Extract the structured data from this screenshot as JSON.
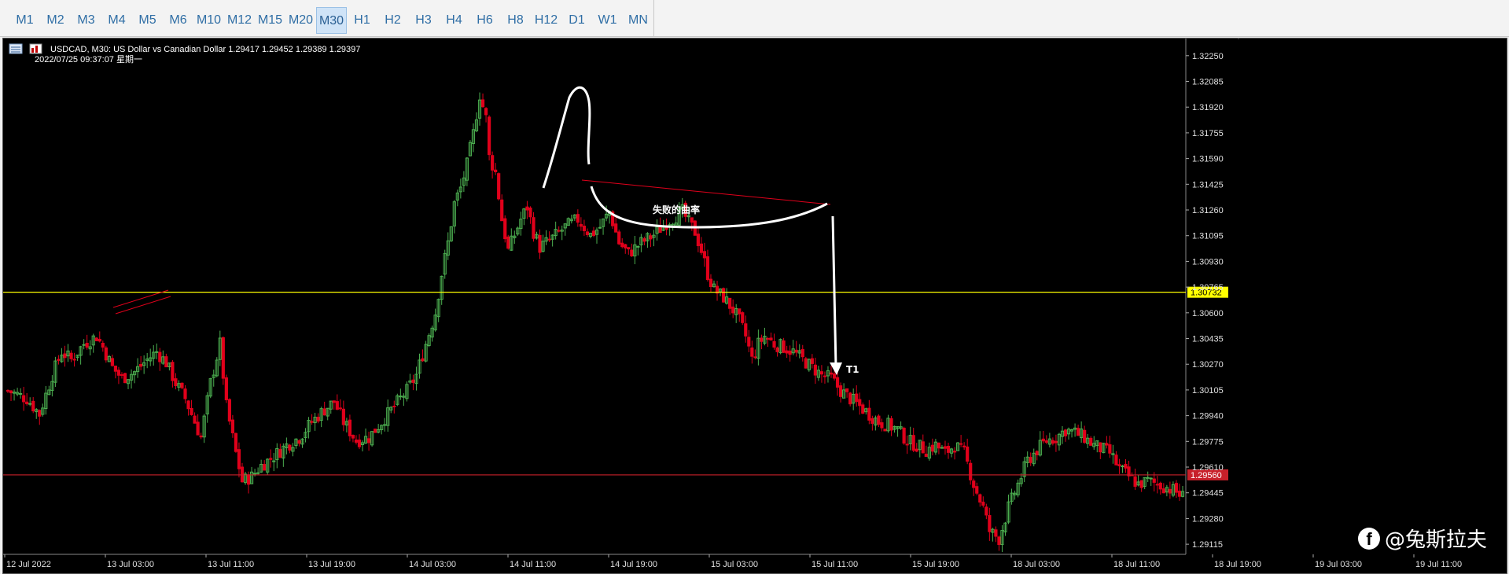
{
  "timeframes": [
    {
      "label": "M1"
    },
    {
      "label": "M2"
    },
    {
      "label": "M3"
    },
    {
      "label": "M4"
    },
    {
      "label": "M5"
    },
    {
      "label": "M6"
    },
    {
      "label": "M10"
    },
    {
      "label": "M12"
    },
    {
      "label": "M15"
    },
    {
      "label": "M20"
    },
    {
      "label": "M30",
      "active": true
    },
    {
      "label": "H1"
    },
    {
      "label": "H2"
    },
    {
      "label": "H3"
    },
    {
      "label": "H4"
    },
    {
      "label": "H6"
    },
    {
      "label": "H8"
    },
    {
      "label": "H12"
    },
    {
      "label": "D1"
    },
    {
      "label": "W1"
    },
    {
      "label": "MN"
    }
  ],
  "chart": {
    "header": "USDCAD, M30:  US Dollar vs Canadian Dollar  1.29417 1.29452 1.29389 1.29397",
    "datetime": "2022/07/25  09:37:07  星期一",
    "colors": {
      "background": "#000000",
      "bull": "#4caf50",
      "bear": "#e0001b",
      "yellow": "#ffff00",
      "red_line": "#c8202a",
      "text": "#ffffff",
      "axis_text": "#e0e0e0"
    }
  },
  "chart_data": {
    "type": "candlestick",
    "symbol": "USDCAD",
    "timeframe": "M30",
    "ylim": [
      1.2905,
      1.3235
    ],
    "price_ticks": [
      "1.32250",
      "1.32085",
      "1.31920",
      "1.31755",
      "1.31590",
      "1.31425",
      "1.31260",
      "1.31095",
      "1.30930",
      "1.30765",
      "1.30600",
      "1.30435",
      "1.30270",
      "1.30105",
      "1.29940",
      "1.29775",
      "1.29610",
      "1.29445",
      "1.29280",
      "1.29115"
    ],
    "time_labels": [
      "12 Jul 2022",
      "13 Jul 03:00",
      "13 Jul 11:00",
      "13 Jul 19:00",
      "14 Jul 03:00",
      "14 Jul 11:00",
      "14 Jul 19:00",
      "15 Jul 03:00",
      "15 Jul 11:00",
      "15 Jul 19:00",
      "18 Jul 03:00",
      "18 Jul 11:00",
      "18 Jul 19:00",
      "19 Jul 03:00",
      "19 Jul 11:00"
    ],
    "horizontal_lines": [
      {
        "price": 1.30732,
        "label": "1.30732",
        "color": "#ffff00"
      },
      {
        "price": 1.2956,
        "label": "1.29560",
        "color": "#c8202a"
      }
    ],
    "annotations": [
      {
        "text": "失败的曲率"
      },
      {
        "text": "T1"
      }
    ],
    "close_path": [
      [
        0,
        1.301
      ],
      [
        6,
        1.3005
      ],
      [
        10,
        1.2995
      ],
      [
        14,
        1.302
      ],
      [
        17,
        1.3035
      ],
      [
        20,
        1.303
      ],
      [
        24,
        1.304
      ],
      [
        28,
        1.3045
      ],
      [
        30,
        1.3038
      ],
      [
        33,
        1.3025
      ],
      [
        36,
        1.3018
      ],
      [
        40,
        1.3022
      ],
      [
        44,
        1.303
      ],
      [
        47,
        1.3035
      ],
      [
        50,
        1.3028
      ],
      [
        53,
        1.3015
      ],
      [
        56,
        1.3005
      ],
      [
        58,
        1.2995
      ],
      [
        61,
        1.298
      ],
      [
        64,
        1.3015
      ],
      [
        67,
        1.304
      ],
      [
        69,
        1.3
      ],
      [
        72,
        1.297
      ],
      [
        74,
        1.2952
      ],
      [
        77,
        1.2955
      ],
      [
        80,
        1.2962
      ],
      [
        84,
        1.2968
      ],
      [
        88,
        1.2975
      ],
      [
        92,
        1.298
      ],
      [
        96,
        1.299
      ],
      [
        100,
        1.2998
      ],
      [
        103,
        1.3003
      ],
      [
        106,
        1.299
      ],
      [
        110,
        1.2978
      ],
      [
        114,
        1.298
      ],
      [
        118,
        1.299
      ],
      [
        122,
        1.3
      ],
      [
        126,
        1.301
      ],
      [
        129,
        1.302
      ],
      [
        132,
        1.304
      ],
      [
        135,
        1.306
      ],
      [
        137,
        1.3085
      ],
      [
        139,
        1.3105
      ],
      [
        141,
        1.313
      ],
      [
        143,
        1.314
      ],
      [
        145,
        1.3155
      ],
      [
        147,
        1.3175
      ],
      [
        149,
        1.32
      ],
      [
        151,
        1.3185
      ],
      [
        152,
        1.316
      ],
      [
        154,
        1.315
      ],
      [
        156,
        1.312
      ],
      [
        158,
        1.31
      ],
      [
        160,
        1.311
      ],
      [
        162,
        1.312
      ],
      [
        164,
        1.3128
      ],
      [
        166,
        1.3112
      ],
      [
        168,
        1.3102
      ],
      [
        172,
        1.3108
      ],
      [
        176,
        1.3115
      ],
      [
        180,
        1.312
      ],
      [
        184,
        1.311
      ],
      [
        187,
        1.3115
      ],
      [
        190,
        1.3125
      ],
      [
        193,
        1.3105
      ],
      [
        196,
        1.3098
      ],
      [
        200,
        1.3105
      ],
      [
        204,
        1.311
      ],
      [
        208,
        1.3118
      ],
      [
        211,
        1.3122
      ],
      [
        213,
        1.3125
      ],
      [
        215,
        1.3118
      ],
      [
        217,
        1.3112
      ],
      [
        219,
        1.31
      ],
      [
        221,
        1.3085
      ],
      [
        223,
        1.3075
      ],
      [
        226,
        1.307
      ],
      [
        229,
        1.3062
      ],
      [
        231,
        1.3055
      ],
      [
        233,
        1.3045
      ],
      [
        235,
        1.303
      ],
      [
        237,
        1.304
      ],
      [
        239,
        1.3045
      ],
      [
        242,
        1.304
      ],
      [
        245,
        1.3038
      ],
      [
        248,
        1.3035
      ],
      [
        251,
        1.303
      ],
      [
        254,
        1.3025
      ],
      [
        257,
        1.302
      ],
      [
        260,
        1.3018
      ],
      [
        263,
        1.301
      ],
      [
        266,
        1.3005
      ],
      [
        269,
        1.3
      ],
      [
        272,
        1.2995
      ],
      [
        275,
        1.299
      ],
      [
        278,
        1.2988
      ],
      [
        281,
        1.2985
      ],
      [
        284,
        1.2978
      ],
      [
        287,
        1.2975
      ],
      [
        290,
        1.2972
      ],
      [
        293,
        1.2975
      ],
      [
        296,
        1.297
      ],
      [
        299,
        1.2975
      ],
      [
        302,
        1.297
      ],
      [
        305,
        1.295
      ],
      [
        308,
        1.2935
      ],
      [
        310,
        1.292
      ],
      [
        313,
        1.2915
      ],
      [
        316,
        1.2935
      ],
      [
        319,
        1.295
      ],
      [
        322,
        1.2965
      ],
      [
        325,
        1.2972
      ],
      [
        328,
        1.2978
      ],
      [
        331,
        1.298
      ],
      [
        334,
        1.2985
      ],
      [
        337,
        1.2983
      ],
      [
        340,
        1.298
      ],
      [
        343,
        1.2975
      ],
      [
        346,
        1.2972
      ],
      [
        348,
        1.297
      ],
      [
        351,
        1.296
      ],
      [
        354,
        1.2955
      ],
      [
        357,
        1.295
      ],
      [
        360,
        1.2952
      ],
      [
        363,
        1.295
      ],
      [
        366,
        1.2948
      ],
      [
        369,
        1.2945
      ],
      [
        371,
        1.2942
      ]
    ]
  }
}
